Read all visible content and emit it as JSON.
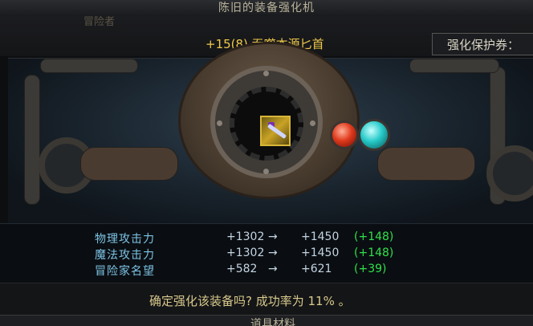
{
  "window": {
    "title": "陈旧的装备强化机"
  },
  "background": {
    "partial_text": "冒险者"
  },
  "item": {
    "name": "+15(8) 吞噬本源匕首",
    "icon": "dagger-icon"
  },
  "protection": {
    "label": "强化保护券："
  },
  "stats": [
    {
      "name": "物理攻击力",
      "before": "+1302",
      "arrow": "→",
      "after": "+1450",
      "delta": "(+148)"
    },
    {
      "name": "魔法攻击力",
      "before": "+1302",
      "arrow": "→",
      "after": "+1450",
      "delta": "(+148)"
    },
    {
      "name": "冒险家名望",
      "before": "+582",
      "arrow": "→",
      "after": "+621",
      "delta": "(+39)"
    }
  ],
  "confirm": {
    "text": "确定强化该装备吗? 成功率为 11% 。"
  },
  "bottom": {
    "partial_text": "道具材料"
  },
  "colors": {
    "item_name": "#f0c94a",
    "stat_name": "#7ec4e6",
    "delta": "#2fe04b",
    "red_orb": "#e03a1c",
    "cyan_orb": "#26c9c9"
  }
}
